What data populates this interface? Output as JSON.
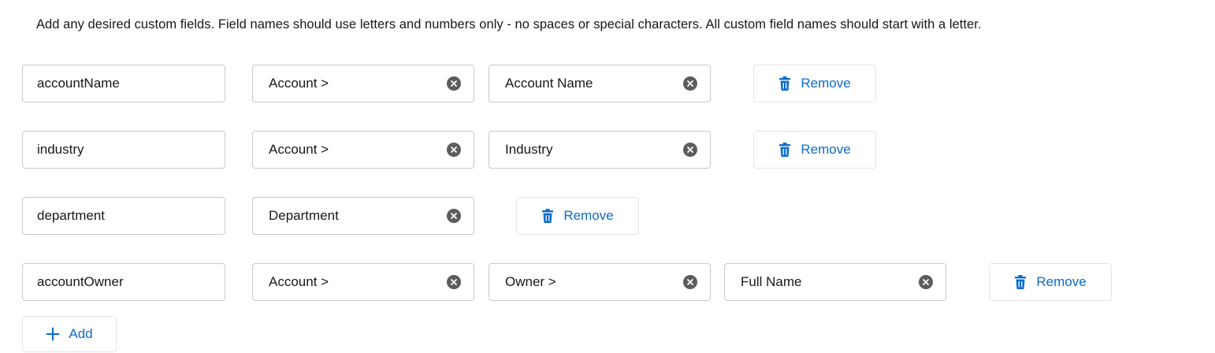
{
  "instructions": "Add any desired custom fields. Field names should use letters and numbers only - no spaces or special characters. All custom field names should start with a letter.",
  "rows": [
    {
      "field_name": "accountName",
      "path": [
        "Account >",
        "Account Name"
      ],
      "remove_label": "Remove"
    },
    {
      "field_name": "industry",
      "path": [
        "Account >",
        "Industry"
      ],
      "remove_label": "Remove"
    },
    {
      "field_name": "department",
      "path": [
        "Department"
      ],
      "remove_label": "Remove"
    },
    {
      "field_name": "accountOwner",
      "path": [
        "Account >",
        "Owner >",
        "Full Name"
      ],
      "remove_label": "Remove"
    }
  ],
  "add_label": "Add",
  "icons": {
    "clear": "clear-x-icon",
    "remove": "trash-icon",
    "add": "plus-icon"
  },
  "colors": {
    "accent": "#0b6bcb",
    "border": "#c9c9c9",
    "clear_icon": "#5c5c5c"
  }
}
